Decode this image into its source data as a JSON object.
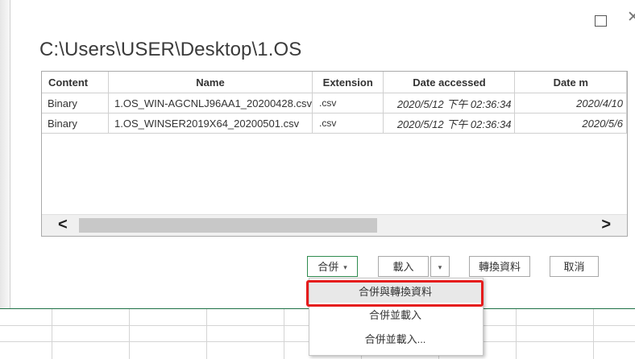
{
  "window": {
    "maximize_icon": "maximize-icon",
    "close_icon": "close-icon"
  },
  "path_title": "C:\\Users\\USER\\Desktop\\1.OS",
  "table": {
    "columns": [
      "Content",
      "Name",
      "Extension",
      "Date accessed",
      "Date m"
    ],
    "rows": [
      [
        "Binary",
        "1.OS_WIN-AGCNLJ96AA1_20200428.csv",
        ".csv",
        "2020/5/12 下午 02:36:34",
        "2020/4/10"
      ],
      [
        "Binary",
        "1.OS_WINSER2019X64_20200501.csv",
        ".csv",
        "2020/5/12 下午 02:36:34",
        "2020/5/6"
      ]
    ]
  },
  "scrollbar": {
    "left_arrow": "<",
    "right_arrow": ">"
  },
  "buttons": {
    "combine": "合併",
    "load": "載入",
    "transform": "轉換資料",
    "cancel": "取消",
    "dropdown_glyph": "▾"
  },
  "combine_menu": {
    "items": [
      "合併與轉換資料",
      "合併並載入",
      "合併並載入..."
    ],
    "highlighted_index": 0
  },
  "colors": {
    "highlight_border": "#e51c1c",
    "excel_green": "#1e7145"
  }
}
